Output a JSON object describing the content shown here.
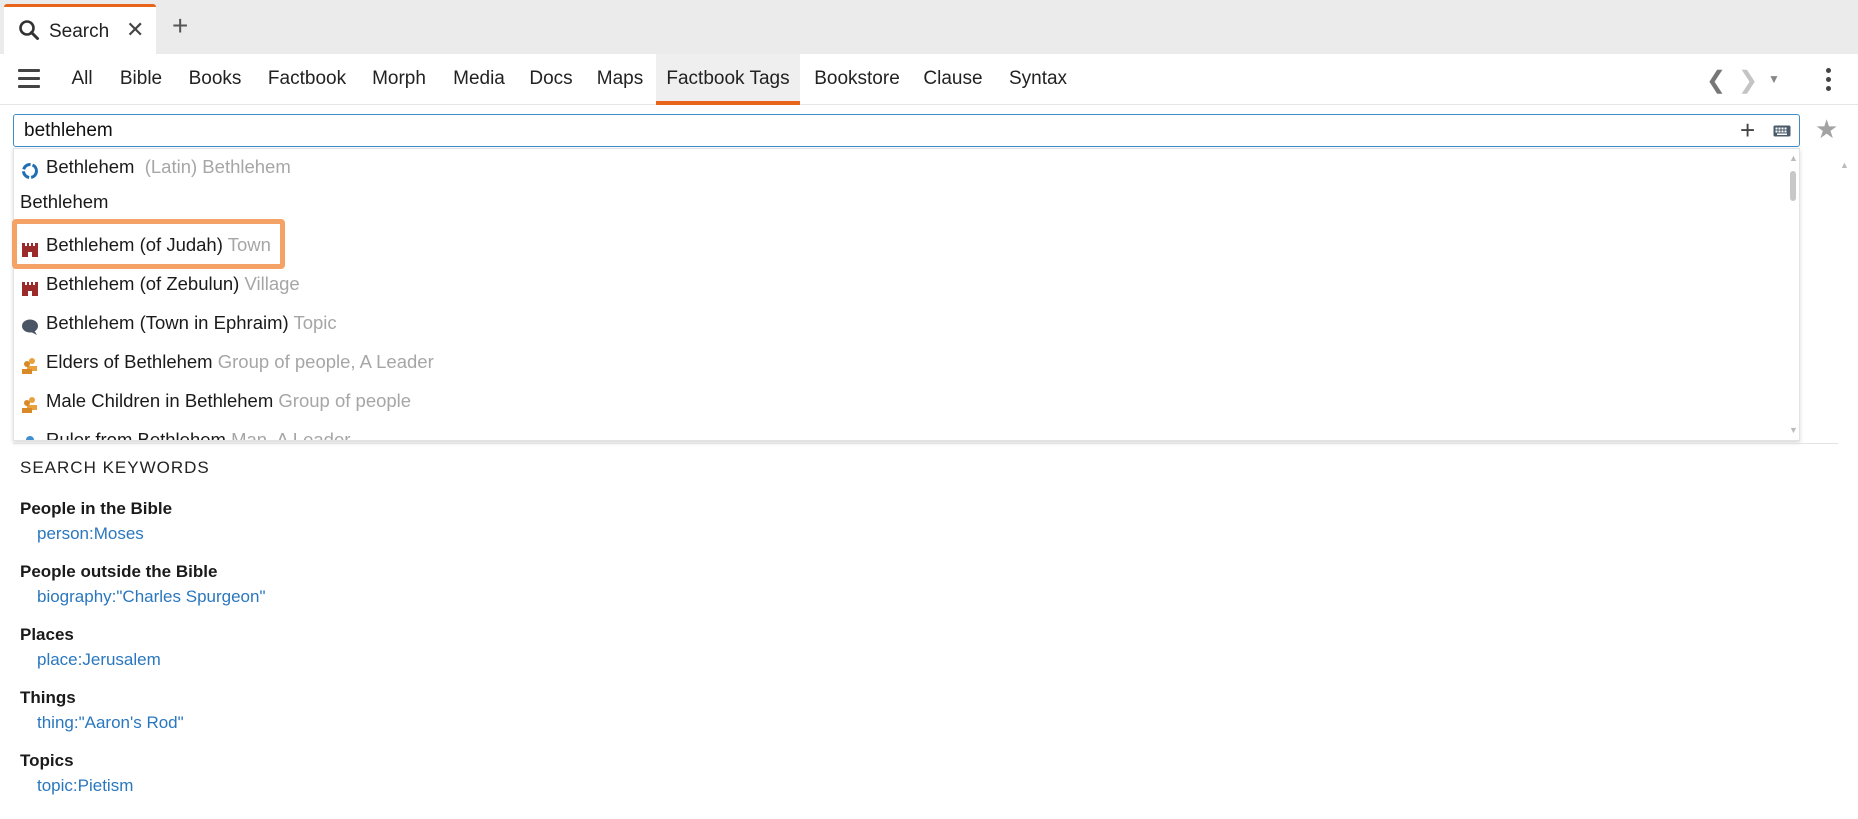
{
  "tab": {
    "title": "Search"
  },
  "categories": [
    "All",
    "Bible",
    "Books",
    "Factbook",
    "Morph",
    "Media",
    "Docs",
    "Maps",
    "Factbook Tags",
    "Bookstore",
    "Clause",
    "Syntax"
  ],
  "active_category": "Factbook Tags",
  "search": {
    "value": "bethlehem",
    "placeholder": ""
  },
  "suggestions": {
    "first": {
      "label": "Bethlehem",
      "hint": "(Latin) Bethlehem",
      "icon": "logos-icon"
    },
    "group_header": "Bethlehem",
    "items": [
      {
        "label": "Bethlehem (of Judah)",
        "hint": "Town",
        "icon": "castle-icon",
        "highlighted": true
      },
      {
        "label": "Bethlehem (of Zebulun)",
        "hint": "Village",
        "icon": "castle-icon"
      },
      {
        "label": "Bethlehem (Town in Ephraim)",
        "hint": "Topic",
        "icon": "speech-bubble-icon"
      },
      {
        "label": "Elders of Bethlehem",
        "hint": "Group of people, A Leader",
        "icon": "group-icon"
      },
      {
        "label": "Male Children in Bethlehem",
        "hint": "Group of people",
        "icon": "group-icon"
      },
      {
        "label": "Ruler from Bethlehem",
        "hint": "Man, A Leader",
        "icon": "person-icon"
      }
    ]
  },
  "keywords": {
    "title": "SEARCH KEYWORDS",
    "sections": [
      {
        "category": "People in the Bible",
        "example": "person:Moses"
      },
      {
        "category": "People outside the Bible",
        "example": "biography:\"Charles Spurgeon\""
      },
      {
        "category": "Places",
        "example": "place:Jerusalem"
      },
      {
        "category": "Things",
        "example": "thing:\"Aaron's Rod\""
      },
      {
        "category": "Topics",
        "example": "topic:Pietism"
      }
    ]
  },
  "colors": {
    "accent": "#e8641a",
    "link": "#2a77be",
    "highlight": "#f4a266",
    "castle": "#9b2b2b",
    "group": "#e9a13b"
  }
}
